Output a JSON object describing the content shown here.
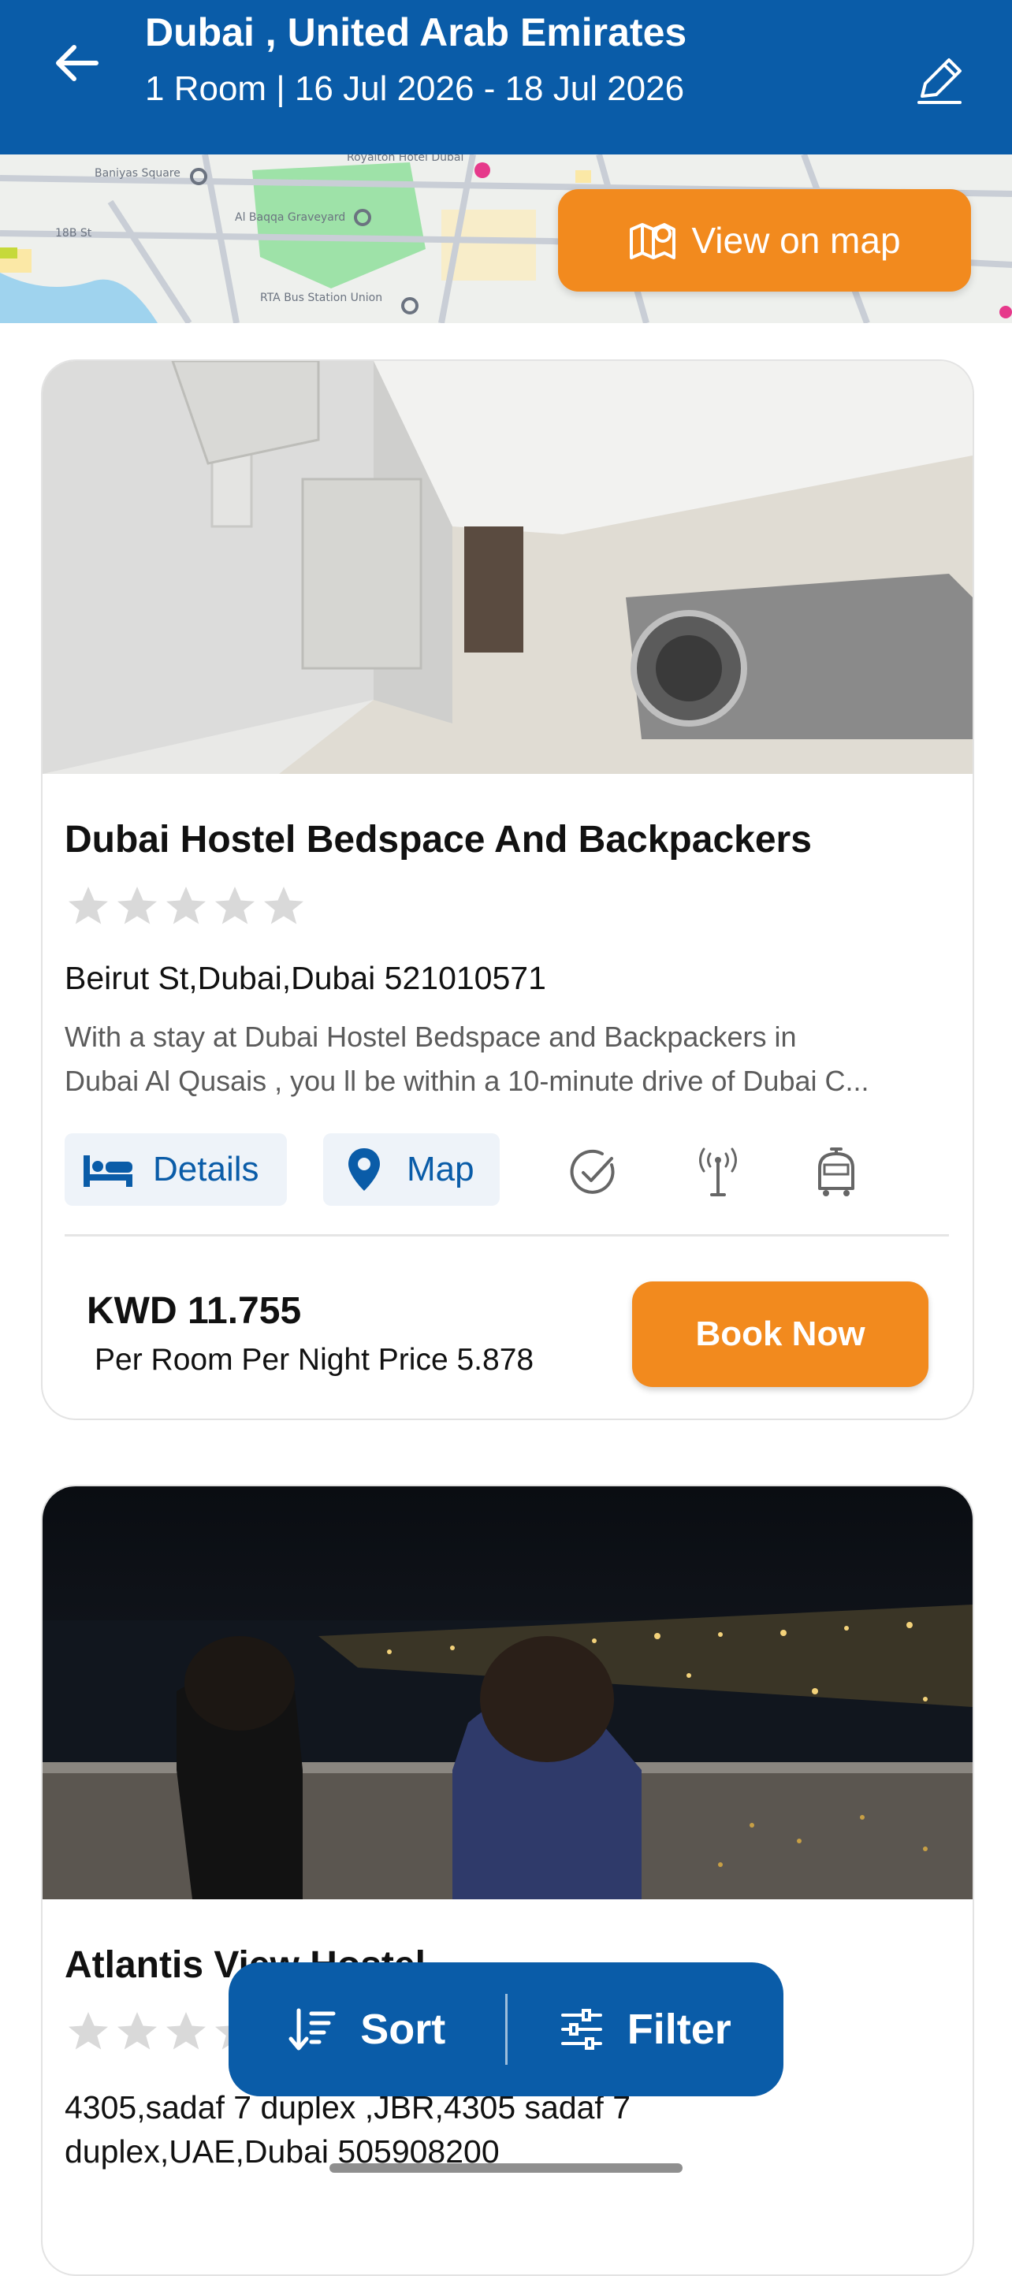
{
  "header": {
    "title": "Dubai , United Arab Emirates",
    "subtitle": "1 Room | 16 Jul 2026 - 18 Jul 2026"
  },
  "map": {
    "view_on_map_label": "View on map",
    "labels": [
      "Baniyas Square",
      "Al Baqqa Graveyard",
      "RTA Bus Station Union",
      "Royalton Hotel Dubai",
      "18B St"
    ]
  },
  "hotels": [
    {
      "name": "Dubai Hostel Bedspace And Backpackers",
      "address": "Beirut St,Dubai,Dubai 521010571",
      "description_line1": "With a stay at Dubai Hostel Bedspace and Backpackers in",
      "description_line2": "Dubai  Al Qusais , you ll be within a 10-minute drive of Dubai C...",
      "details_label": "Details",
      "map_label": "Map",
      "price": "KWD 11.755",
      "per_night": "Per Room Per Night Price 5.878",
      "book_label": "Book Now",
      "rating_stars": 0,
      "amenities": [
        "check-icon",
        "wifi-antenna-icon",
        "shuttle-icon"
      ]
    },
    {
      "name": "Atlantis View Hostel",
      "address_line1": "4305,sadaf 7 duplex ,JBR,4305 sadaf 7",
      "address_line2": "duplex,UAE,Dubai 505908200",
      "rating_stars": 0
    }
  ],
  "bottom_bar": {
    "sort_label": "Sort",
    "filter_label": "Filter"
  },
  "colors": {
    "primary": "#0a5ca8",
    "accent": "#f28a1e",
    "star_empty": "#d9d9d9"
  }
}
